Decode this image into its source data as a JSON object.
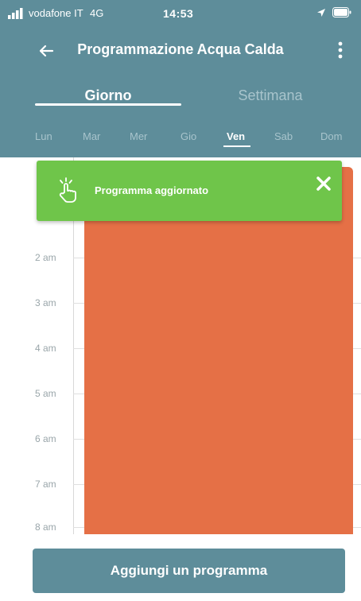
{
  "status_bar": {
    "carrier": "vodafone IT",
    "network": "4G",
    "time": "14:53"
  },
  "header": {
    "title": "Programmazione Acqua Calda",
    "back_icon": "arrow-left-icon",
    "menu_icon": "more-vertical-icon"
  },
  "tabs": [
    {
      "label": "Giorno",
      "active": true
    },
    {
      "label": "Settimana",
      "active": false
    }
  ],
  "days": [
    {
      "label": "Lun",
      "active": false
    },
    {
      "label": "Mar",
      "active": false
    },
    {
      "label": "Mer",
      "active": false
    },
    {
      "label": "Gio",
      "active": false
    },
    {
      "label": "Ven",
      "active": true
    },
    {
      "label": "Sab",
      "active": false
    },
    {
      "label": "Dom",
      "active": false
    }
  ],
  "schedule": {
    "hours": [
      "2 am",
      "3 am",
      "4 am",
      "5 am",
      "6 am",
      "7 am",
      "8 am"
    ],
    "block_color": "#e57046"
  },
  "toast": {
    "message": "Programma aggiornato",
    "color": "#6fc54a",
    "icon": "tap-hand-icon"
  },
  "actions": {
    "add_label": "Aggiungi un programma"
  },
  "colors": {
    "header": "#5e8d9a",
    "button": "#5e8d9a"
  }
}
